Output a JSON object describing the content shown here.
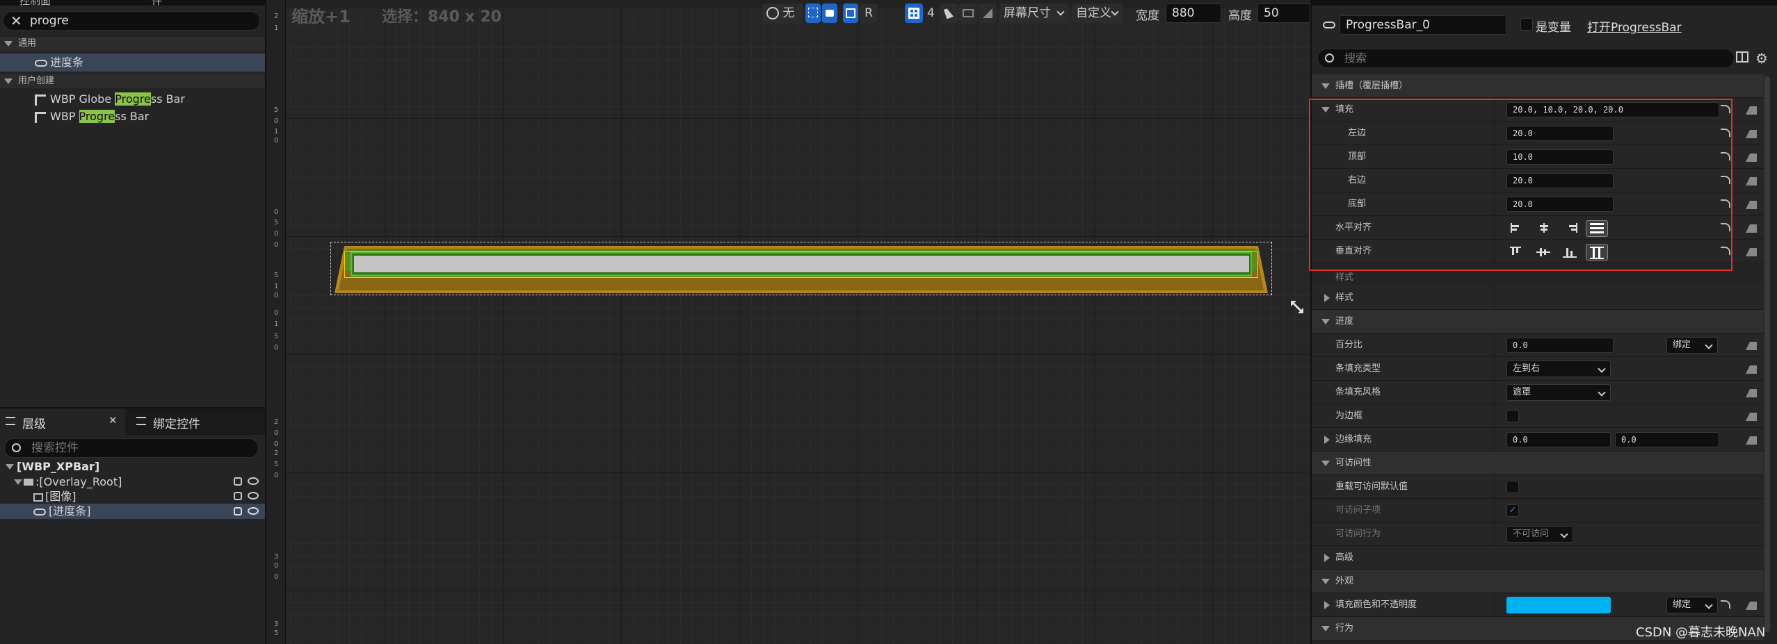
{
  "left_panel": {
    "tab1": "控制面",
    "tab2": "件",
    "search_value": "progre",
    "categories": [
      {
        "label": "通用",
        "items": [
          {
            "label": "进度条"
          }
        ]
      },
      {
        "label": "用户创建",
        "items": [
          {
            "pre": "WBP Globe ",
            "hl": "Progre",
            "post": "ss Bar"
          },
          {
            "pre": "WBP ",
            "hl": "Progre",
            "post": "ss Bar"
          }
        ]
      }
    ],
    "hierarchy_tab": "层级",
    "bind_tab": "绑定控件",
    "hier_search_placeholder": "搜索控件",
    "tree": [
      "[WBP_XPBar]",
      ":[Overlay_Root]",
      "[图像]",
      "[进度条]"
    ]
  },
  "viewport": {
    "zoom_label": "缩放+1",
    "selection_label": "选择：840 x 20",
    "toolbar": {
      "none_label": "无",
      "r_label": "R",
      "grid_count": "4",
      "screen_size": "屏幕尺寸",
      "custom": "自定义",
      "width_label": "宽度",
      "width_value": "880",
      "height_label": "高度",
      "height_value": "50"
    },
    "ruler_v": [
      "2",
      "1",
      "5",
      "0",
      "1",
      "0",
      "0",
      "5",
      "0",
      "0",
      "5",
      "1",
      "0",
      "0",
      "1",
      "5",
      "0",
      "2",
      "0",
      "0",
      "2",
      "5",
      "0",
      "3",
      "0",
      "0",
      "3",
      "5"
    ]
  },
  "details": {
    "name_value": "ProgressBar_0",
    "is_variable_label": "是变量",
    "open_link": "打开ProgressBar",
    "search_placeholder": "搜索",
    "slot_header": "插槽（覆层插槽）",
    "padding_label": "填充",
    "padding_value": "20.0, 10.0, 20.0, 20.0",
    "left_label": "左边",
    "left_value": "20.0",
    "top_label": "顶部",
    "top_value": "10.0",
    "right_label": "右边",
    "right_value": "20.0",
    "bottom_label": "底部",
    "bottom_value": "20.0",
    "h_align_label": "水平对齐",
    "v_align_label": "垂直对齐",
    "style_cut": "样式",
    "style_label": "样式",
    "progress_header": "进度",
    "percent_label": "百分比",
    "percent_value": "0.0",
    "bind_label": "绑定",
    "fill_type_label": "条填充类型",
    "fill_type_value": "左到右",
    "fill_style_label": "条填充风格",
    "fill_style_value": "遮罩",
    "is_marquee_label": "为边框",
    "border_padding_label": "边缘填充",
    "border_x": "0.0",
    "border_y": "0.0",
    "access_header": "可访问性",
    "override_label": "重载可访问默认值",
    "children_label": "可访问子项",
    "behavior_label": "可访问行为",
    "behavior_value": "不可访问",
    "advanced_label": "高级",
    "appearance_header": "外观",
    "fill_color_label": "填充颜色和不透明度",
    "bind2_label": "绑定",
    "behavior_header": "行为",
    "fill_color": "#00b2f0"
  },
  "watermark": "CSDN @暮志未晚NAN",
  "colors": {
    "highlight_box": "#e03030",
    "accent_blue": "#1f66c6",
    "match_green": "#8ac24a"
  }
}
